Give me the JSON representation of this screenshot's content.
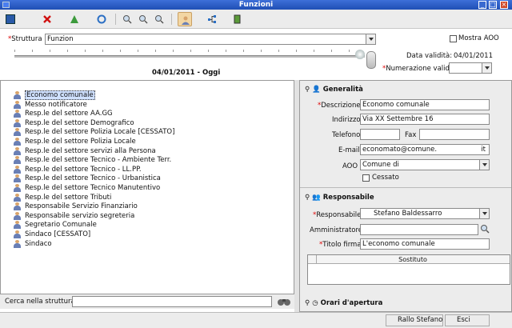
{
  "window": {
    "title": "Funzioni"
  },
  "filter": {
    "struttura_label": "Struttura",
    "struttura_value": "Funzion",
    "mostra_aoo_label": "Mostra AOO",
    "data_validita_label": "Data validità:",
    "data_validita_value": "04/01/2011",
    "numerazione_label": "Numerazione validità:",
    "date_range": "04/01/2011 - Oggi"
  },
  "tree": {
    "items": [
      "Economo comunale",
      "Messo notificatore",
      "Resp.le del settore AA.GG",
      "Resp.le del settore Demografico",
      "Resp.le del settore Polizia Locale [CESSATO]",
      "Resp.le del settore Polizia Locale",
      "Resp.le del settore servizi alla Persona",
      "Resp.le del settore Tecnico - Ambiente Terr.",
      "Resp.le del settore Tecnico - LL.PP.",
      "Resp.le del settore Tecnico - Urbanistica",
      "Resp.le del settore Tecnico Manutentivo",
      "Resp.le del settore Tributi",
      "Responsabile Servizio Finanziario",
      "Responsabile servizio segreteria",
      "Segretario Comunale",
      "Sindaco [CESSATO]",
      "Sindaco"
    ]
  },
  "search": {
    "label": "Cerca nella struttura"
  },
  "detail": {
    "generalita_title": "Generalità",
    "descrizione_label": "Descrizione",
    "descrizione_value": "Economo comunale",
    "indirizzo_label": "Indirizzo",
    "indirizzo_value": "Via XX Settembre 16",
    "telefono_label": "Telefono",
    "fax_label": "Fax",
    "email_label": "E-mail",
    "email_value": "economato@comune.",
    "email_suffix": "it",
    "aoo_label": "AOO",
    "aoo_value": "Comune di",
    "cessato_label": "Cessato",
    "responsabile_title": "Responsabile",
    "responsabile_label": "Responsabile",
    "responsabile_value": "Stefano Baldessarro",
    "amministratore_label": "Amministratore",
    "titolo_firma_label": "Titolo firma",
    "titolo_firma_value": "L'economo comunale",
    "sostituto_header": "Sostituto",
    "orari_title": "Orari d'apertura"
  },
  "status": {
    "user": "Rallo Stefano",
    "exit": "Esci"
  }
}
